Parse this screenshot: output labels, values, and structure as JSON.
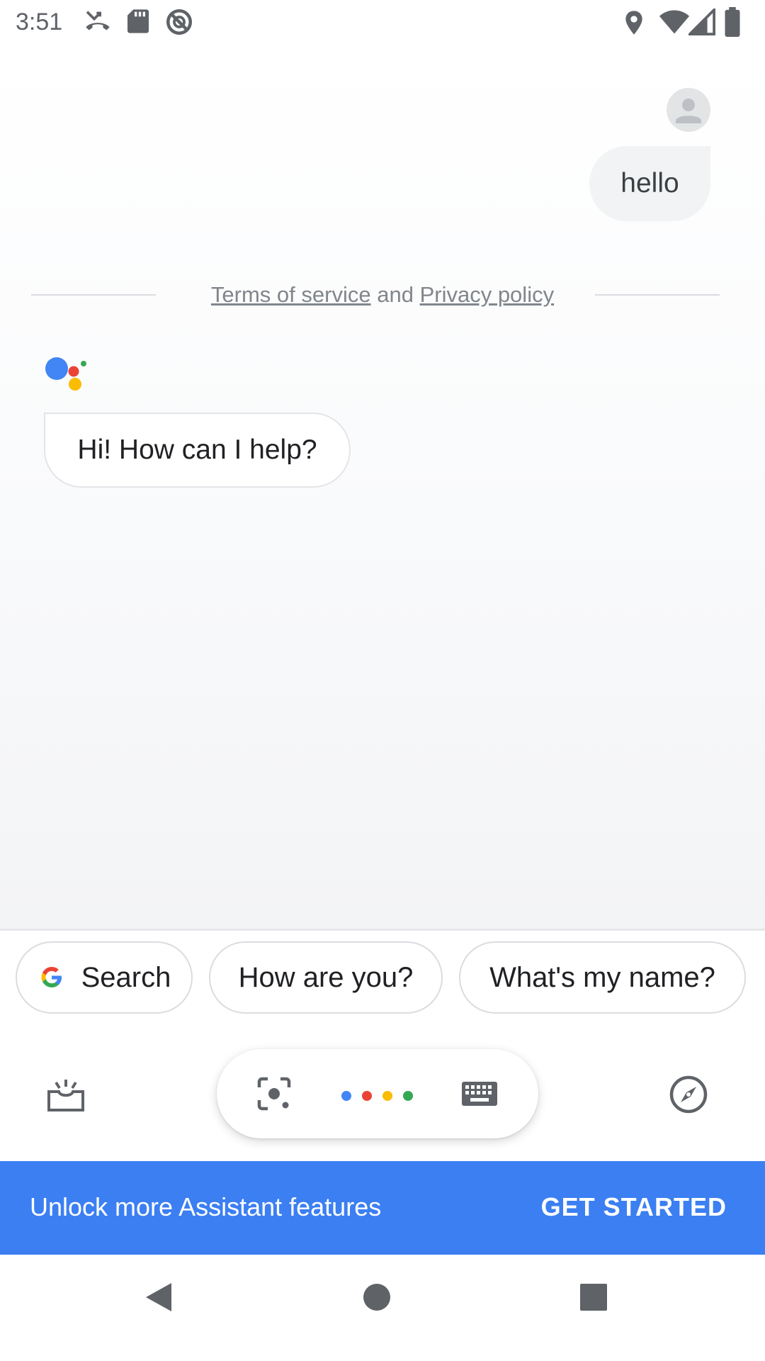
{
  "status_bar": {
    "time": "3:51",
    "left_icons": [
      "missed-call-icon",
      "sd-card-icon",
      "no-disturb-icon"
    ],
    "right_icons": [
      "location-icon",
      "wifi-icon",
      "signal-icon",
      "battery-icon"
    ]
  },
  "chat": {
    "user_message": "hello",
    "terms": {
      "terms_label": "Terms of service",
      "and_label": "and",
      "privacy_label": "Privacy policy"
    },
    "assistant_message": "Hi! How can I help?"
  },
  "suggestions": {
    "search_label": "Search",
    "chip_2": "How are you?",
    "chip_3": "What's my name?"
  },
  "controls": {
    "left_icon": "snapshot-tray-icon",
    "lens_icon": "lens-icon",
    "keyboard_icon": "keyboard-icon",
    "right_icon": "explore-compass-icon",
    "dot_colors": [
      "#4285F4",
      "#EA4335",
      "#FBBC04",
      "#34A853"
    ]
  },
  "banner": {
    "text": "Unlock more Assistant features",
    "button": "GET STARTED",
    "color": "#3b7ff2"
  },
  "nav": {
    "back": "back-icon",
    "home": "home-icon",
    "recents": "recents-icon"
  }
}
